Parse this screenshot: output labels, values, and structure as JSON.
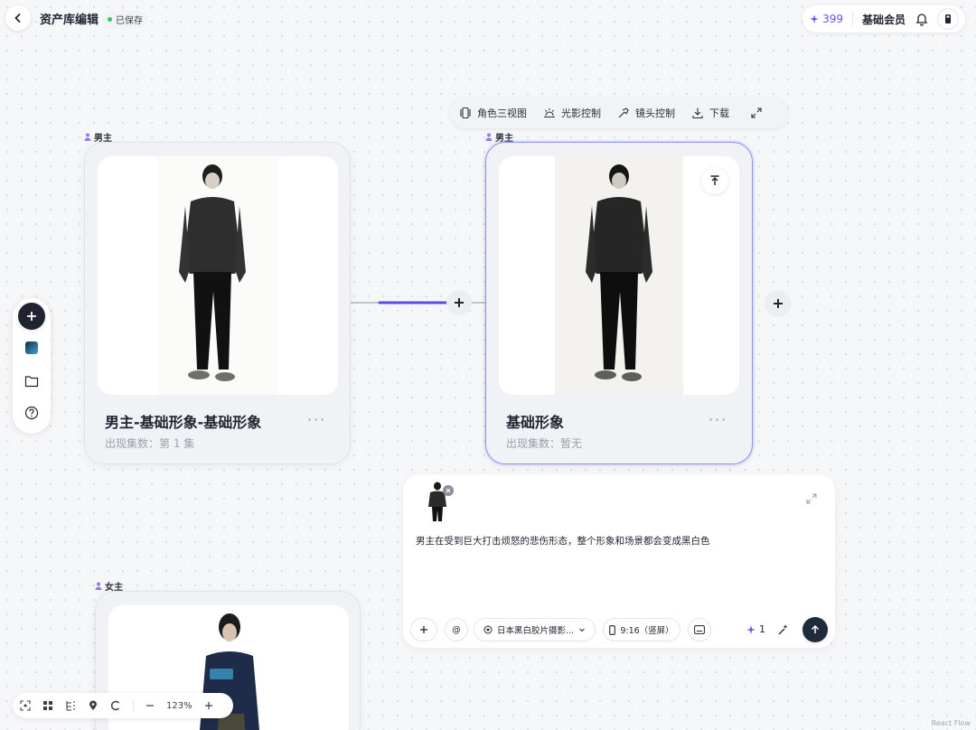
{
  "header": {
    "title": "资产库编辑",
    "saved_label": "已保存"
  },
  "account": {
    "credits": "399",
    "membership": "基础会员"
  },
  "toolbar": {
    "items": [
      {
        "label": "角色三视图",
        "icon": "three-view-icon"
      },
      {
        "label": "光影控制",
        "icon": "lighting-icon"
      },
      {
        "label": "镜头控制",
        "icon": "camera-icon"
      },
      {
        "label": "下载",
        "icon": "download-icon"
      }
    ]
  },
  "nodes": [
    {
      "tag": "男主",
      "title": "男主-基础形象-基础形象",
      "subtitle": "出现集数：第 1 集",
      "more": "···"
    },
    {
      "tag": "男主",
      "title": "基础形象",
      "subtitle": "出现集数：暂无",
      "more": "···"
    },
    {
      "tag": "女主"
    }
  ],
  "prompt": {
    "text": "男主在受到巨大打击烦怒的悲伤形态，整个形象和场景都会变成黑白色",
    "at_label": "@",
    "style_label": "日本黑白胶片摄影...",
    "ratio_label": "9:16（竖屏）",
    "count": "1"
  },
  "zoom": {
    "level": "123%"
  },
  "watermark": "React Flow",
  "colors": {
    "accent": "#6a4cf0",
    "selection": "#8b8ff0",
    "edge": "#5b4de0"
  }
}
